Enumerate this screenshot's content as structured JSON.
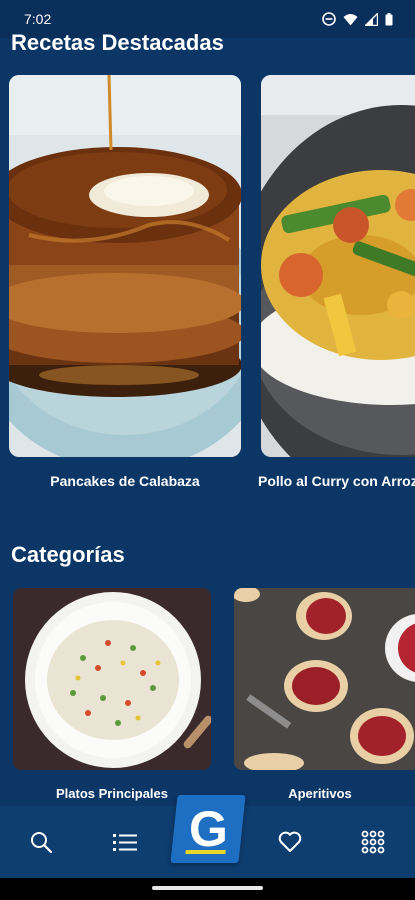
{
  "status_bar": {
    "time": "7:02"
  },
  "featured": {
    "title": "Recetas Destacadas",
    "items": [
      {
        "label": "Pancakes de Calabaza"
      },
      {
        "label": "Pollo al Curry con Arroz"
      }
    ]
  },
  "categories": {
    "title": "Categorías",
    "items": [
      {
        "label": "Platos Principales"
      },
      {
        "label": "Aperitivos"
      }
    ]
  },
  "nav": {
    "logo_letter": "G",
    "items": [
      "search-icon",
      "list-icon",
      "heart-icon",
      "grid-icon"
    ]
  },
  "colors": {
    "background": "#0c3666",
    "nav": "#0e3d70",
    "logo": "#1e6fc3",
    "logo_stripe": "#e8d628"
  }
}
